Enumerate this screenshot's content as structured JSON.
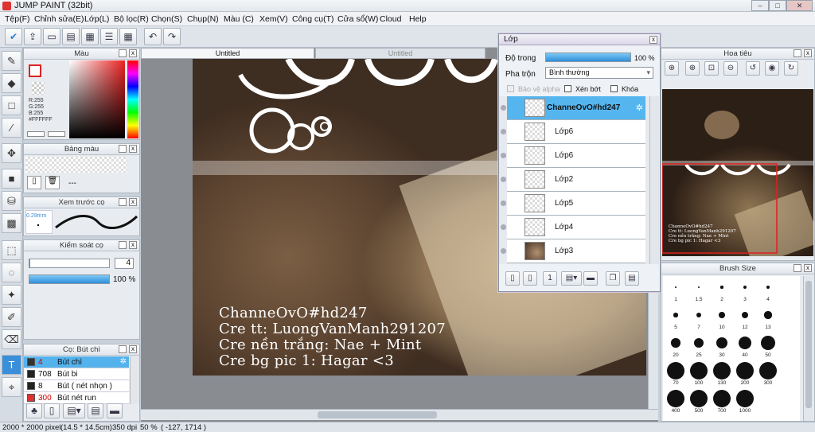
{
  "window": {
    "title": "JUMP PAINT (32bit)",
    "minimize": "–",
    "maximize": "□",
    "close": "✕"
  },
  "menu": [
    "Tệp(F)",
    "Chỉnh sửa(E)",
    "Lớp(L)",
    "Bộ lọc(R)",
    "Chọn(S)",
    "Chụp(N)",
    "Màu (C)",
    "Xem(V)",
    "Công cụ(T)",
    "Cửa sổ(W)",
    "Cloud",
    "Help"
  ],
  "tabs": {
    "active": "Untitled",
    "inactive": "Untitled"
  },
  "color_panel": {
    "title": "Màu",
    "r": "R:255",
    "g": "G:255",
    "b": "B:255",
    "hex": "#FFFFFF"
  },
  "palette_panel": {
    "title": "Bảng màu",
    "value": "---"
  },
  "brush_preview": {
    "title": "Xem trước cọ",
    "size": "0.29mm"
  },
  "control_panel": {
    "title": "Kiểm soát cọ",
    "size_value": "4",
    "opacity_value": "100 %",
    "size_fill": 0.01,
    "opacity_fill": 1.0
  },
  "brush_list": {
    "title": "Cọ: Bút chì",
    "items": [
      {
        "size": "4",
        "name": "Bút chì",
        "color": "#333333",
        "selected": true
      },
      {
        "size": "708",
        "name": "Bút bi",
        "color": "#222222",
        "selected": false
      },
      {
        "size": "8",
        "name": "Bút ( nét nhọn )",
        "color": "#222222",
        "selected": false
      },
      {
        "size": "300",
        "name": "Bút nét run",
        "color": "#e03030",
        "selected": false
      }
    ]
  },
  "credits": [
    "ChanneOvO#hd247",
    "Cre tt: LuongVanManh291207",
    "Cre nền trắng: Nae + Mint",
    "Cre bg pic 1: Hagar <3"
  ],
  "layers": {
    "title": "Lớp",
    "opacity_label": "Độ trong",
    "opacity_value": "100 %",
    "opacity_fill": 1.0,
    "blend_label": "Pha trộn",
    "blend_value": "Bình thường",
    "protect_alpha": "Bảo vệ alpha",
    "clip": "Xén bớt",
    "lock": "Khóa",
    "items": [
      {
        "name": "ChanneOvO#hd247",
        "selected": true
      },
      {
        "name": "Lớp6",
        "selected": false
      },
      {
        "name": "Lớp6",
        "selected": false
      },
      {
        "name": "Lớp2",
        "selected": false
      },
      {
        "name": "Lớp5",
        "selected": false
      },
      {
        "name": "Lớp4",
        "selected": false
      },
      {
        "name": "Lớp3",
        "selected": false
      }
    ]
  },
  "navigator": {
    "title": "Hoa tiêu",
    "preview_credits": [
      "ChanneOvO#hd247",
      "Cre tt: LuongVanManh291207",
      "Cre nền trắng: Nae + Mint",
      "Cre bg pic 1: Hagar <3"
    ]
  },
  "brush_size": {
    "title": "Brush Size",
    "sizes": [
      "1",
      "1.5",
      "2",
      "3",
      "4",
      "5",
      "7",
      "10",
      "12",
      "13",
      "20",
      "25",
      "30",
      "40",
      "50",
      "70",
      "100",
      "130",
      "200",
      "300",
      "400",
      "500",
      "700",
      "1000"
    ]
  },
  "status": {
    "dimensions": "2000 * 2000 pixel",
    "physical": "(14.5 * 14.5cm)",
    "dpi": "350 dpi",
    "zoom": "50 %",
    "coords": "( -127, 1714 )"
  }
}
